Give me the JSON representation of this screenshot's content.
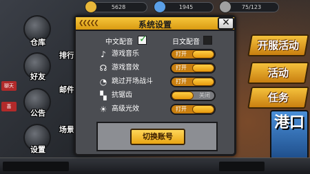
{
  "topbar": {
    "resources": [
      {
        "value": "5628",
        "icon": "coin-icon",
        "color": "#e8b73a"
      },
      {
        "value": "1945",
        "icon": "gem-icon",
        "color": "#5aa0e8"
      },
      {
        "value": "75/123",
        "icon": "energy-icon",
        "color": "#a0a0a0"
      }
    ]
  },
  "left_menu": [
    {
      "label": "仓库",
      "icon": "warehouse-icon"
    },
    {
      "label": "好友",
      "icon": "friends-icon"
    },
    {
      "label": "公告",
      "icon": "megaphone-icon"
    },
    {
      "label": "设置",
      "icon": "gear-icon"
    }
  ],
  "left_menu_partial": [
    {
      "label": "排行"
    },
    {
      "label": "邮件"
    },
    {
      "label": "场景"
    }
  ],
  "side_tags": [
    {
      "label": "聊天"
    },
    {
      "label": "喜"
    }
  ],
  "right_menu": [
    {
      "label": "开服活动"
    },
    {
      "label": "活动"
    },
    {
      "label": "任务"
    }
  ],
  "go_button": {
    "label": "港口"
  },
  "settings": {
    "title": "系统设置",
    "close_label": "✕",
    "chinese_voice": {
      "label": "中文配音",
      "checked": true
    },
    "japanese_voice": {
      "label": "日文配音",
      "checked": false
    },
    "options": [
      {
        "label": "游戏音乐",
        "icon": "music-note-icon",
        "state": "on",
        "text": "打开"
      },
      {
        "label": "游戏音效",
        "icon": "headphones-icon",
        "state": "on",
        "text": "打开"
      },
      {
        "label": "跳过开场战斗",
        "icon": "skip-icon",
        "state": "on",
        "text": "打开"
      },
      {
        "label": "抗锯齿",
        "icon": "antialias-icon",
        "state": "off",
        "text": "关闭"
      },
      {
        "label": "高级光效",
        "icon": "sun-icon",
        "state": "on",
        "text": "打开"
      }
    ],
    "switch_account_label": "切换账号"
  },
  "colors": {
    "accent": "#f6c63b",
    "panel": "#4b4d52",
    "check_green": "#1f9a2a"
  }
}
